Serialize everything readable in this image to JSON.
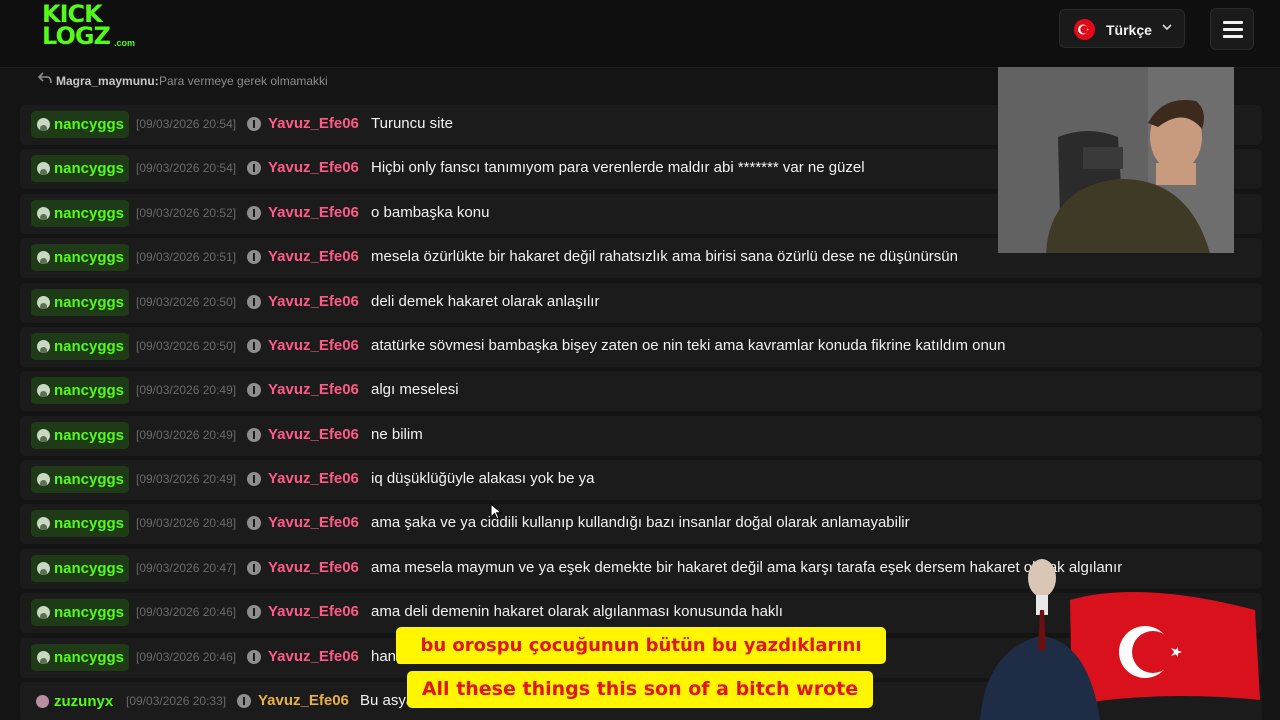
{
  "header": {
    "logo_line1": "KICK",
    "logo_line2": "LOGZ",
    "logo_domain": ".com",
    "language_label": "Türkçe"
  },
  "reply": {
    "user": "Magra_maymunu:",
    "text": "Para vermeye gerek olmamakki"
  },
  "messages": [
    {
      "user": "nancyggs",
      "time": "[09/03/2026 20:54]",
      "target": "Yavuz_Efe06",
      "text": "Turuncu site"
    },
    {
      "user": "nancyggs",
      "time": "[09/03/2026 20:54]",
      "target": "Yavuz_Efe06",
      "text": "Hiçbi only fanscı tanımıyom para verenlerde maldır abi ******* var ne güzel"
    },
    {
      "user": "nancyggs",
      "time": "[09/03/2026 20:52]",
      "target": "Yavuz_Efe06",
      "text": "o bambaşka konu"
    },
    {
      "user": "nancyggs",
      "time": "[09/03/2026 20:51]",
      "target": "Yavuz_Efe06",
      "text": "mesela özürlükte bir hakaret değil rahatsızlık ama birisi sana özürlü dese ne düşünürsün"
    },
    {
      "user": "nancyggs",
      "time": "[09/03/2026 20:50]",
      "target": "Yavuz_Efe06",
      "text": "deli demek hakaret olarak anlaşılır"
    },
    {
      "user": "nancyggs",
      "time": "[09/03/2026 20:50]",
      "target": "Yavuz_Efe06",
      "text": "atatürke sövmesi bambaşka bişey zaten oe nin teki ama kavramlar konuda fikrine katıldım onun"
    },
    {
      "user": "nancyggs",
      "time": "[09/03/2026 20:49]",
      "target": "Yavuz_Efe06",
      "text": "algı meselesi"
    },
    {
      "user": "nancyggs",
      "time": "[09/03/2026 20:49]",
      "target": "Yavuz_Efe06",
      "text": "ne bilim"
    },
    {
      "user": "nancyggs",
      "time": "[09/03/2026 20:49]",
      "target": "Yavuz_Efe06",
      "text": "iq düşüklüğüyle alakası yok be ya"
    },
    {
      "user": "nancyggs",
      "time": "[09/03/2026 20:48]",
      "target": "Yavuz_Efe06",
      "text": "ama şaka ve ya ciddili kullanıp kullandığı bazı insanlar doğal olarak anlamayabilir"
    },
    {
      "user": "nancyggs",
      "time": "[09/03/2026 20:47]",
      "target": "Yavuz_Efe06",
      "text": "ama mesela maymun ve ya eşek demekte bir hakaret değil ama karşı tarafa eşek dersem hakaret olarak algılanır"
    },
    {
      "user": "nancyggs",
      "time": "[09/03/2026 20:46]",
      "target": "Yavuz_Efe06",
      "text": "ama deli demenin hakaret olarak algılanması konusunda haklı"
    },
    {
      "user": "nancyggs",
      "time": "[09/03/2026 20:46]",
      "target": "Yavuz_Efe06",
      "text": "hang"
    },
    {
      "user": "zuzunyx",
      "time": "[09/03/2026 20:33]",
      "target": "Yavuz_Efe06",
      "text": "Bu asya"
    }
  ],
  "subtitles": {
    "line1": "bu orospu çocuğunun bütün bu yazdıklarını",
    "line2": "All these things this son of a bitch wrote"
  },
  "colors": {
    "accent": "#53fc18",
    "target_user": "#ff5a87",
    "target_user_alt": "#e8b04a",
    "subtitle_bg": "#fff600",
    "subtitle_text": "#e0161c"
  }
}
